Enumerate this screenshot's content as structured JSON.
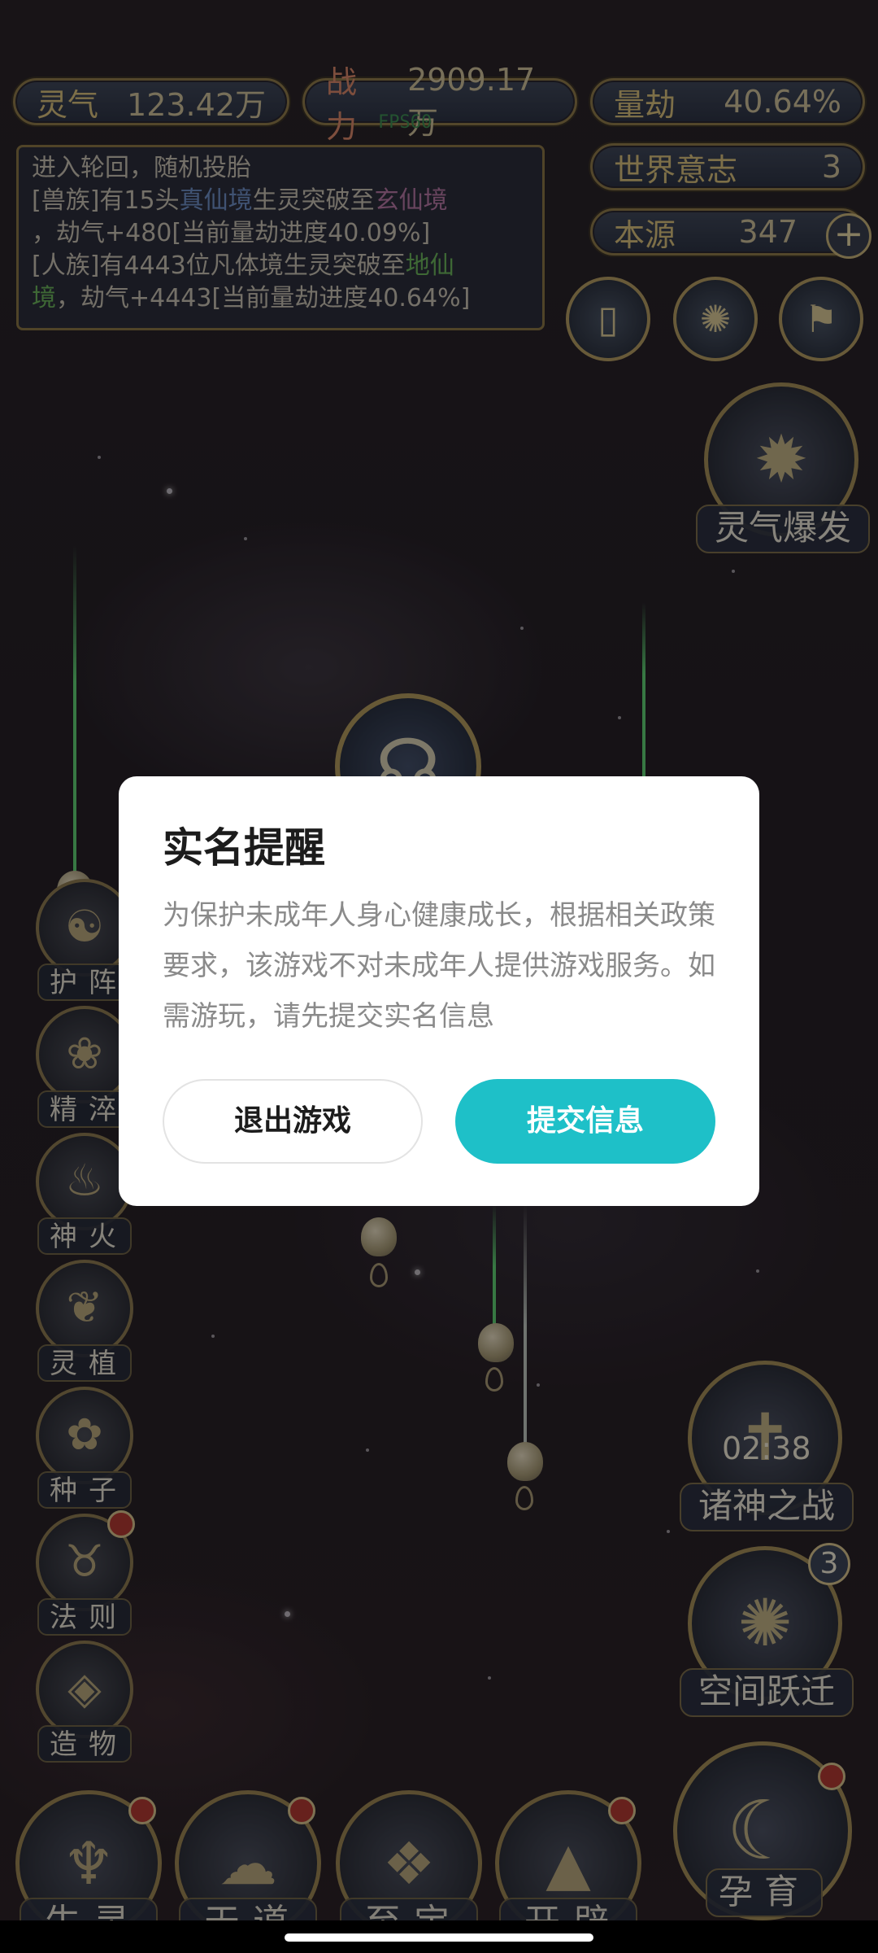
{
  "hud": {
    "lingqi": {
      "label": "灵气",
      "value": "123.42万"
    },
    "zhanli": {
      "label": "战力",
      "value": "2909.17万"
    },
    "liangjie": {
      "label": "量劫",
      "value": "40.64%"
    },
    "world_will": {
      "label": "世界意志",
      "value": "3"
    },
    "benyuan": {
      "label": "本源",
      "value": "347"
    },
    "plus_symbol": "+",
    "fps": "FPS60"
  },
  "log": {
    "line1": "进入轮回，随机投胎",
    "line2_prefix": "[兽族]有15头",
    "line2_realm1": "真仙境",
    "line2_mid": "生灵突破至",
    "line2_realm2": "玄仙境",
    "line3": "，劫气+480[当前量劫进度40.09%]",
    "line4_prefix": "[人族]有4443位凡体境生灵突破至",
    "line4_realm": "地仙",
    "line5_realm": "境",
    "line5_rest": "，劫气+4443[当前量劫进度40.64%]"
  },
  "top_icons": [
    {
      "icon": "card-icon"
    },
    {
      "icon": "vortex-icon"
    },
    {
      "icon": "flag-icon"
    }
  ],
  "lingqi_burst": {
    "label": "灵气爆发"
  },
  "left_menu": [
    {
      "label": "护阵",
      "icon": "yin-yang-icon",
      "badge": false
    },
    {
      "label": "精淬",
      "icon": "lotus-icon",
      "badge": false
    },
    {
      "label": "神火",
      "icon": "flame-icon",
      "badge": false
    },
    {
      "label": "灵植",
      "icon": "plant-icon",
      "badge": false
    },
    {
      "label": "种子",
      "icon": "seed-icon",
      "badge": false
    },
    {
      "label": "法则",
      "icon": "beast-icon",
      "badge": true
    },
    {
      "label": "造物",
      "icon": "diamond-icon",
      "badge": false
    }
  ],
  "right_menu": {
    "gods_war": {
      "label": "诸神之战",
      "timer": "02:38"
    },
    "space_jump": {
      "label": "空间跃迁",
      "count": "3"
    },
    "nurture": {
      "label": "孕育"
    }
  },
  "bottom_menu": [
    {
      "label": "生灵",
      "icon": "phoenix-icon",
      "badge": true
    },
    {
      "label": "天道",
      "icon": "cloud-icon",
      "badge": true
    },
    {
      "label": "至宝",
      "icon": "treasure-icon",
      "badge": false
    },
    {
      "label": "开辟",
      "icon": "mountain-icon",
      "badge": true
    }
  ],
  "dialog": {
    "title": "实名提醒",
    "message": "为保护未成年人身心健康成长，根据相关政策要求，该游戏不对未成年人提供游戏服务。如需游玩，请先提交实名信息",
    "exit_label": "退出游戏",
    "submit_label": "提交信息"
  },
  "colors": {
    "accent": "#1ec0c8",
    "dialog_bg": "#ffffff",
    "title_text": "#1c1c1c",
    "body_text": "#8a8a8a"
  }
}
